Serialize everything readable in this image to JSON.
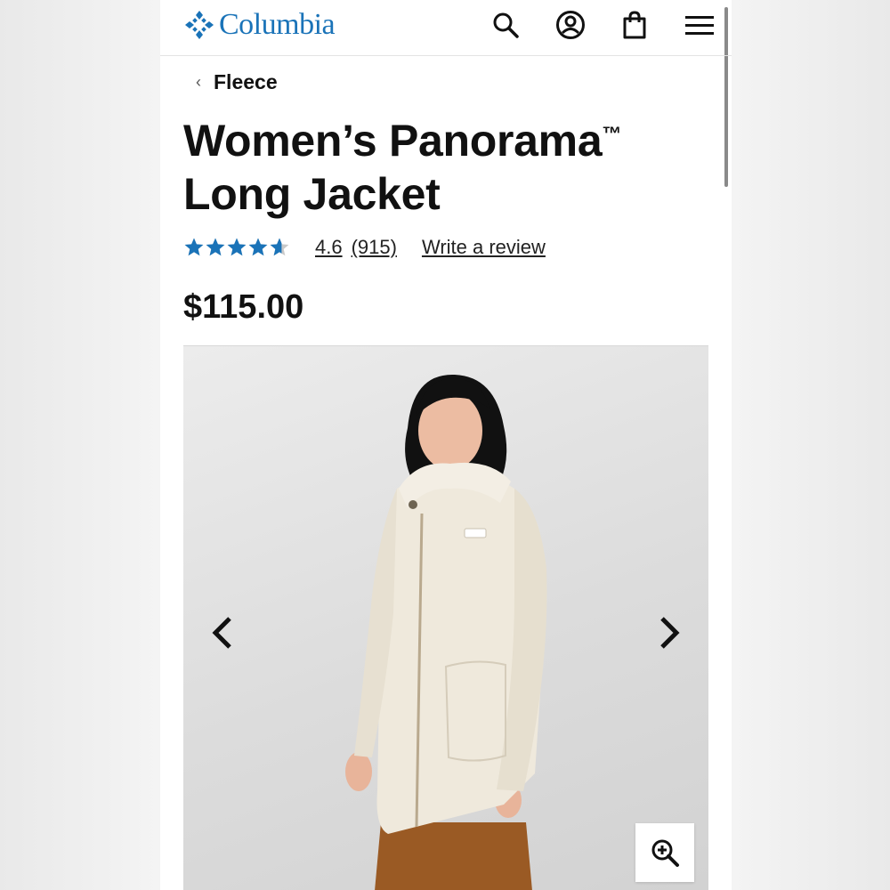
{
  "brand": {
    "name": "Columbia",
    "color": "#1a73b8"
  },
  "header": {
    "icons": [
      "search-icon",
      "account-icon",
      "cart-icon",
      "menu-icon"
    ]
  },
  "breadcrumb": {
    "back_icon": "‹",
    "label": "Fleece"
  },
  "product": {
    "title_main": "Women’s Panorama",
    "trademark": "™",
    "title_second_line": "Long Jacket",
    "rating_value": "4.6",
    "rating_stars": 4.6,
    "max_stars": 5,
    "review_count": "(915)",
    "write_review_label": "Write a review",
    "price": "$115.00",
    "star_color": "#1a73b8"
  },
  "gallery": {
    "image_alt": "Model wearing cream fleece long jacket",
    "prev_icon": "chevron-left-icon",
    "next_icon": "chevron-right-icon",
    "zoom_icon": "zoom-in-icon"
  }
}
